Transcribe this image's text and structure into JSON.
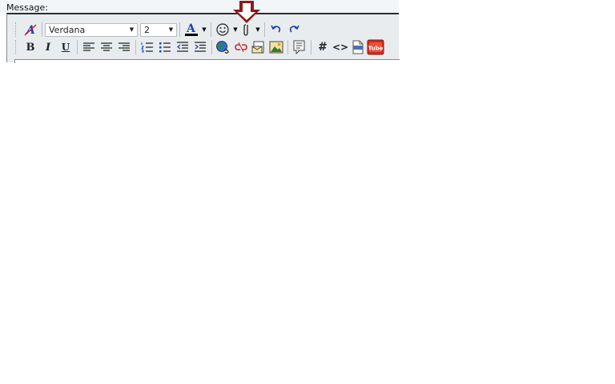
{
  "message_label": "Message:",
  "toolbar": {
    "font_name": "Verdana",
    "font_size": "2",
    "bold_label": "B",
    "italic_label": "I",
    "underline_label": "U",
    "hash_label": "#",
    "code_label": "<>"
  },
  "colors": {
    "arrow": "#7a1a1a",
    "link_blue": "#1a3fb0",
    "youtube_red": "#d42a1a"
  }
}
